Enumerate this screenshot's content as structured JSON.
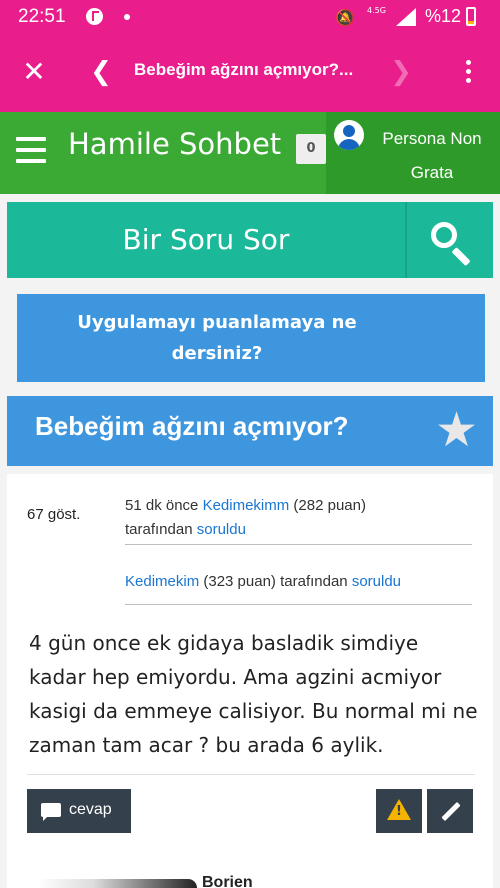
{
  "status_bar": {
    "time": "22:51",
    "network": "4.5G",
    "battery": "%12"
  },
  "nav": {
    "title": "Bebeğim ağzını açmıyor?...",
    "icons": [
      "close-icon",
      "back-icon",
      "forward-icon",
      "more-vert-icon"
    ]
  },
  "header": {
    "brand": "Hamile Sohbet",
    "notification_count": "0",
    "user_name": "Persona Non Grata"
  },
  "ask": {
    "label": "Bir Soru Sor"
  },
  "rate_prompt": {
    "text": "Uygulamayı puanlamaya ne dersiniz?"
  },
  "question": {
    "title": "Bebeğim ağzını açmıyor?",
    "views": "67 göst.",
    "asked": {
      "time": "51 dk önce",
      "user": "Kedimekimm",
      "points": "(282 puan)",
      "by": "tarafından",
      "action": "soruldu"
    },
    "edited": {
      "user": "Kedimekim",
      "points": "(323 puan)",
      "by": "tarafından",
      "action": "soruldu"
    },
    "body": "4 gün once ek gidaya basladik simdiye kadar hep emiyordu. Ama agzini acmiyor kasigi da emmeye calisiyor. Bu normal mi ne zaman tam acar ? bu arada 6 aylik.",
    "reply_label": "cevap",
    "next_answer_name": "Borien"
  },
  "colors": {
    "pink": "#e91e8c",
    "green": "#3aaa34",
    "teal": "#1bb99a",
    "blue": "#3d96de",
    "dark": "#34404c"
  }
}
